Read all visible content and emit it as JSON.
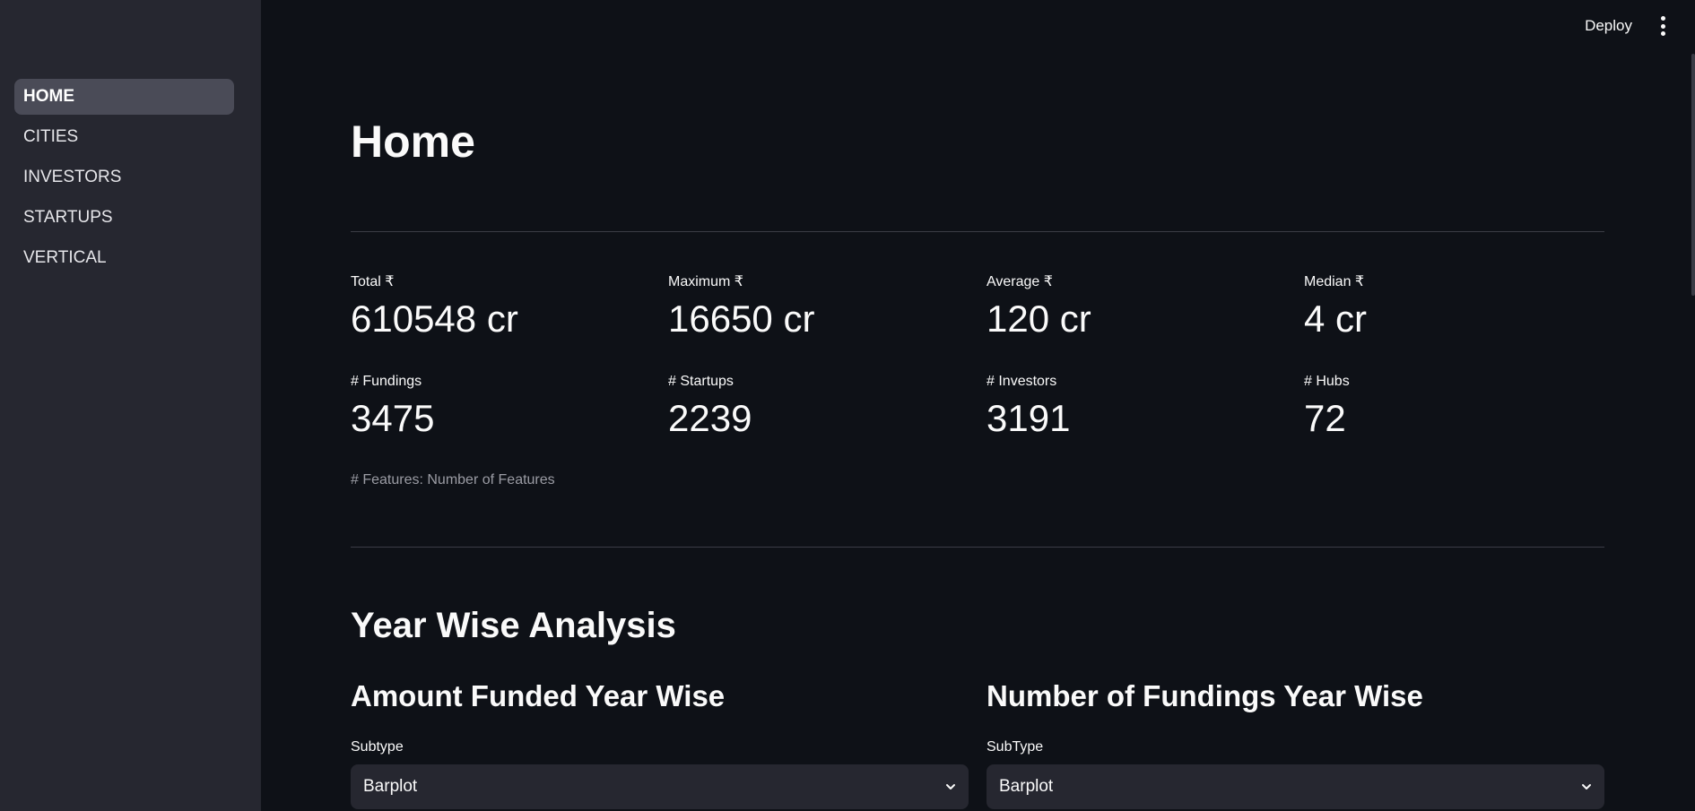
{
  "sidebar": {
    "items": [
      {
        "label": "HOME",
        "active": true
      },
      {
        "label": "CITIES"
      },
      {
        "label": "INVESTORS"
      },
      {
        "label": "STARTUPS"
      },
      {
        "label": "VERTICAL"
      }
    ]
  },
  "topbar": {
    "deploy_label": "Deploy",
    "menu_icon": "more-vertical-icon"
  },
  "page": {
    "title": "Home"
  },
  "metrics": [
    {
      "label": "Total ₹",
      "value": "610548 cr"
    },
    {
      "label": "Maximum ₹",
      "value": "16650 cr"
    },
    {
      "label": "Average ₹",
      "value": "120 cr"
    },
    {
      "label": "Median ₹",
      "value": "4 cr"
    },
    {
      "label": "# Fundings",
      "value": "3475"
    },
    {
      "label": "# Startups",
      "value": "2239"
    },
    {
      "label": "# Investors",
      "value": "3191"
    },
    {
      "label": "# Hubs",
      "value": "72"
    }
  ],
  "caption": "# Features: Number of Features",
  "year_wise": {
    "title": "Year Wise Analysis",
    "left": {
      "title": "Amount Funded Year Wise",
      "field_label": "Subtype",
      "selected": "Barplot"
    },
    "right": {
      "title": "Number of Fundings Year Wise",
      "field_label": "SubType",
      "selected": "Barplot"
    }
  },
  "colors": {
    "background": "#0e1117",
    "sidebar": "#262730",
    "active_item": "#4a4b57"
  }
}
